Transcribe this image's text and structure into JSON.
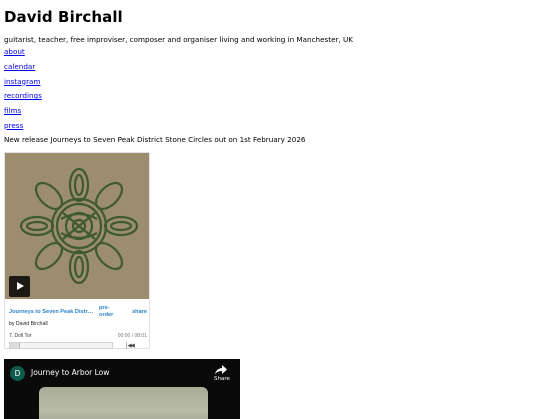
{
  "header": {
    "title": "David Birchall",
    "tagline": "guitarist, teacher, free improviser, composer and organiser living and working in Manchester, UK"
  },
  "nav": {
    "items": [
      {
        "label": "about"
      },
      {
        "label": "calendar"
      },
      {
        "label": "instagram"
      },
      {
        "label": "recordings"
      },
      {
        "label": "films"
      },
      {
        "label": "press"
      }
    ]
  },
  "release": {
    "announcement": "New release Journeys to Seven Peak District Stone Circles out on 1st February 2026"
  },
  "bandcamp": {
    "album_title": "Journeys to Seven Peak District Stone Circles",
    "preorder_label": "pre-order",
    "share_label": "share",
    "byline": "by David Birchall",
    "track": "7. Doll Tor",
    "time": "00:00 / 08:01",
    "skip_icon": "skip-icon",
    "play_icon": "play-icon",
    "progress": 0
  },
  "youtube": {
    "avatar_letter": "D",
    "title": "Journey to Arbor Low",
    "share_label": "Share",
    "share_icon": "share-arrow-icon"
  },
  "colors": {
    "link": "#0000ee",
    "bandcamp_accent": "#2a82c9",
    "cover_background": "#9c8c70",
    "cover_ink": "#3f5a2d",
    "youtube_background": "#0a0a0a",
    "youtube_avatar": "#0f5b4b"
  }
}
